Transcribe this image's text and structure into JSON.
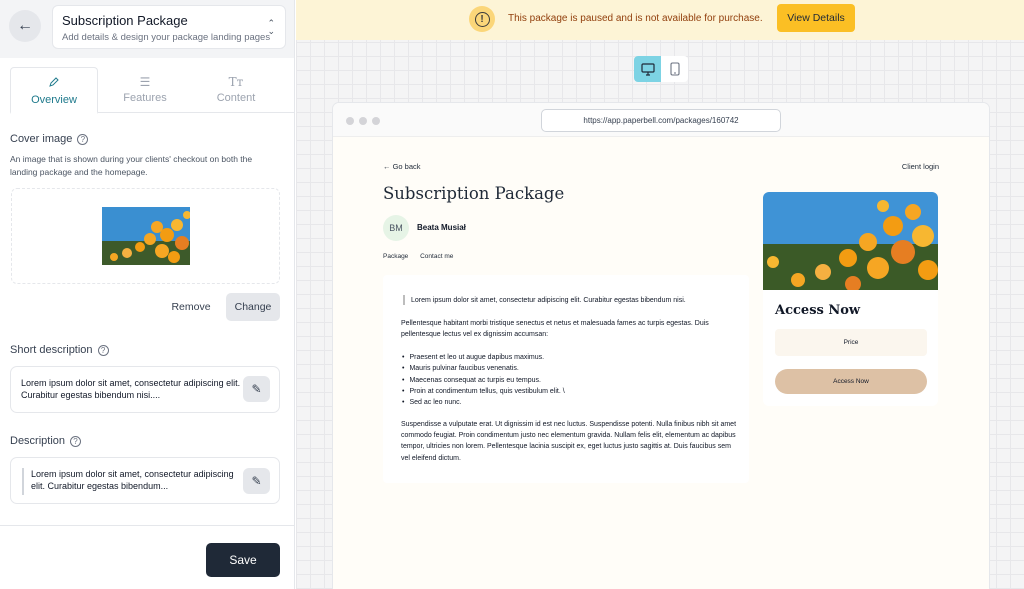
{
  "header": {
    "package_title": "Subscription Package",
    "package_subtitle": "Add details & design your package landing pages"
  },
  "tabs": [
    {
      "label": "Overview",
      "icon": "pencil-icon",
      "active": true
    },
    {
      "label": "Features",
      "icon": "list-icon",
      "active": false
    },
    {
      "label": "Content",
      "icon": "text-size-icon",
      "active": false
    }
  ],
  "cover": {
    "title": "Cover image",
    "description": "An image that is shown during your clients' checkout on both the landing package and the homepage.",
    "remove_label": "Remove",
    "change_label": "Change"
  },
  "short_description": {
    "title": "Short description",
    "value": "Lorem ipsum dolor sit amet, consectetur adipiscing elit. Curabitur egestas bibendum nisi...."
  },
  "description": {
    "title": "Description",
    "value": "Lorem ipsum dolor sit amet, consectetur adipiscing elit. Curabitur egestas bibendum..."
  },
  "footer": {
    "save_label": "Save"
  },
  "banner": {
    "message": "This package is paused and is not available for purchase.",
    "button_label": "View Details",
    "color": "#fdf4d6",
    "button_color": "#fbbf24"
  },
  "preview": {
    "mode": "desktop",
    "url": "https://app.paperbell.com/packages/160742",
    "back_link": "← Go back",
    "client_login": "Client login",
    "title": "Subscription Package",
    "coach_initials": "BM",
    "coach_name": "Beata Musiał",
    "nav": [
      "Package",
      "Contact me"
    ],
    "quote": "Lorem ipsum dolor sit amet, consectetur adipiscing elit. Curabitur egestas bibendum nisi.",
    "paragraph1": "Pellentesque habitant morbi tristique senectus et netus et malesuada fames ac turpis egestas. Duis pellentesque lectus vel ex dignissim accumsan:",
    "list": [
      "Praesent et leo ut augue dapibus maximus.",
      "Mauris pulvinar faucibus venenatis.",
      "Maecenas consequat ac turpis eu tempus.",
      "Proin at condimentum tellus, quis vestibulum elit. \\",
      "Sed ac leo nunc."
    ],
    "paragraph2": "Suspendisse a vulputate erat. Ut dignissim id est nec luctus. Suspendisse potenti. Nulla finibus nibh sit amet commodo feugiat. Proin condimentum justo nec elementum gravida. Nullam felis elit, elementum ac dapibus tempor, ultricies non lorem. Pellentesque lacinia suscipit ex, eget luctus justo sagittis at. Duis faucibus sem vel eleifend dictum.",
    "access_title": "Access Now",
    "price_label": "Price",
    "access_button": "Access Now",
    "accent_color": "#ddc1a5"
  }
}
